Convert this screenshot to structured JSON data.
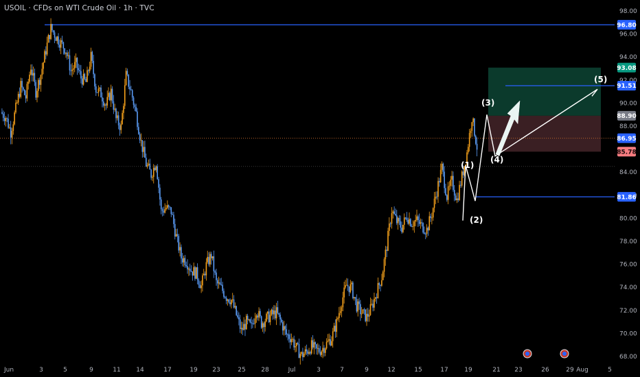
{
  "header": {
    "symbol_line": "USOIL · CFDs on WTI Crude Oil · 1h · TVC"
  },
  "colors": {
    "background": "#000000",
    "up_candle": "#f7a21b",
    "down_candle": "#5b9cf6",
    "level_line": "#2962ff",
    "target_zone": "#0b3a2c",
    "stop_zone": "#3a1f23",
    "price_tag_blue": "#2962ff",
    "price_tag_green": "#089981",
    "price_tag_gray": "#787b86",
    "price_tag_red": "#f77c80",
    "wave_lines": "#ffffff"
  },
  "chart_data": {
    "type": "candlestick",
    "title": "USOIL · CFDs on WTI Crude Oil · 1h · TVC",
    "ylim": [
      67.4,
      98.6
    ],
    "y_ticks": [
      "98.00",
      "96.00",
      "94.00",
      "92.00",
      "90.00",
      "88.00",
      "84.00",
      "82.00",
      "80.00",
      "78.00",
      "76.00",
      "74.00",
      "72.00",
      "70.00",
      "68.00"
    ],
    "x_ticks": [
      "Jun",
      "3",
      "5",
      "9",
      "11",
      "14",
      "17",
      "19",
      "23",
      "25",
      "28",
      "Jul",
      "3",
      "7",
      "9",
      "12",
      "15",
      "17",
      "19",
      "21",
      "23",
      "26",
      "29",
      "Aug",
      "5"
    ],
    "price_path": [
      [
        0,
        89.2
      ],
      [
        1,
        88.8
      ],
      [
        2,
        87.5
      ],
      [
        3,
        89.5
      ],
      [
        4,
        91.5
      ],
      [
        5,
        90.5
      ],
      [
        6,
        93.2
      ],
      [
        7,
        91.0
      ],
      [
        8,
        92.5
      ],
      [
        9,
        94.6
      ],
      [
        10,
        96.5
      ],
      [
        11,
        95.8
      ],
      [
        12,
        95.2
      ],
      [
        13,
        94.6
      ],
      [
        14,
        92.8
      ],
      [
        15,
        93.4
      ],
      [
        16,
        92.2
      ],
      [
        17,
        91.8
      ],
      [
        18,
        94.0
      ],
      [
        19,
        91.2
      ],
      [
        20,
        90.8
      ],
      [
        21,
        89.8
      ],
      [
        22,
        91.0
      ],
      [
        23,
        88.6
      ],
      [
        24,
        87.9
      ],
      [
        25,
        92.4
      ],
      [
        26,
        91.0
      ],
      [
        27,
        89.1
      ],
      [
        28,
        86.6
      ],
      [
        29,
        84.7
      ],
      [
        30,
        83.8
      ],
      [
        31,
        84.9
      ],
      [
        32,
        80.6
      ],
      [
        33,
        80.9
      ],
      [
        34,
        80.6
      ],
      [
        35,
        78.4
      ],
      [
        36,
        76.6
      ],
      [
        37,
        76.3
      ],
      [
        38,
        75.5
      ],
      [
        39,
        75.2
      ],
      [
        40,
        74.1
      ],
      [
        41,
        75.9
      ],
      [
        42,
        76.8
      ],
      [
        43,
        74.4
      ],
      [
        44,
        73.9
      ],
      [
        45,
        73.2
      ],
      [
        46,
        72.9
      ],
      [
        47,
        71.6
      ],
      [
        48,
        70.2
      ],
      [
        49,
        71.0
      ],
      [
        50,
        70.5
      ],
      [
        51,
        72.1
      ],
      [
        52,
        70.9
      ],
      [
        53,
        71.3
      ],
      [
        54,
        71.6
      ],
      [
        55,
        71.8
      ],
      [
        56,
        70.9
      ],
      [
        57,
        69.9
      ],
      [
        58,
        69.6
      ],
      [
        59,
        68.7
      ],
      [
        60,
        68.1
      ],
      [
        61,
        68.4
      ],
      [
        62,
        68.9
      ],
      [
        63,
        68.5
      ],
      [
        64,
        68.6
      ],
      [
        65,
        69.1
      ],
      [
        66,
        69.6
      ],
      [
        67,
        70.9
      ],
      [
        68,
        72.8
      ],
      [
        69,
        74.2
      ],
      [
        70,
        73.9
      ],
      [
        71,
        72.4
      ],
      [
        72,
        71.8
      ],
      [
        73,
        71.4
      ],
      [
        74,
        72.3
      ],
      [
        75,
        73.6
      ],
      [
        76,
        74.9
      ],
      [
        77,
        77.6
      ],
      [
        78,
        80.7
      ],
      [
        79,
        79.7
      ],
      [
        80,
        79.2
      ],
      [
        81,
        80.2
      ],
      [
        82,
        79.6
      ],
      [
        83,
        79.8
      ],
      [
        84,
        79.3
      ],
      [
        85,
        79.0
      ],
      [
        86,
        80.4
      ],
      [
        87,
        82.4
      ],
      [
        88,
        84.4
      ],
      [
        89,
        81.9
      ],
      [
        90,
        83.2
      ],
      [
        91,
        81.6
      ],
      [
        92,
        83.6
      ],
      [
        93,
        85.7
      ],
      [
        94,
        88.8
      ],
      [
        95,
        86.2
      ]
    ],
    "horizontal_levels": [
      {
        "label": "96.80",
        "value": 96.8,
        "tag_color": "#2962ff"
      },
      {
        "label": "91.51",
        "value": 91.51,
        "tag_color": "#2962ff"
      },
      {
        "label": "81.86",
        "value": 81.86,
        "tag_color": "#2962ff"
      }
    ],
    "price_tags": [
      {
        "label": "93.08",
        "value": 93.08,
        "tag_color": "#089981"
      },
      {
        "label": "88.90",
        "value": 88.9,
        "tag_color": "#787b86"
      },
      {
        "label": "86.95",
        "value": 86.95,
        "tag_color": "#2962ff"
      },
      {
        "label": "85.78",
        "value": 85.78,
        "tag_color": "#f77c80",
        "text_color": "#1a0a0c"
      }
    ],
    "current_price": 86.95,
    "position_zone": {
      "entry": 88.9,
      "target": 93.08,
      "stop": 85.78
    },
    "elliott_labels": [
      {
        "label": "(1)",
        "value": 84.6
      },
      {
        "label": "(2)",
        "value": 80.0
      },
      {
        "label": "(3)",
        "value": 89.9
      },
      {
        "label": "(4)",
        "value": 85.0
      },
      {
        "label": "(5)",
        "value": 91.6
      }
    ]
  }
}
